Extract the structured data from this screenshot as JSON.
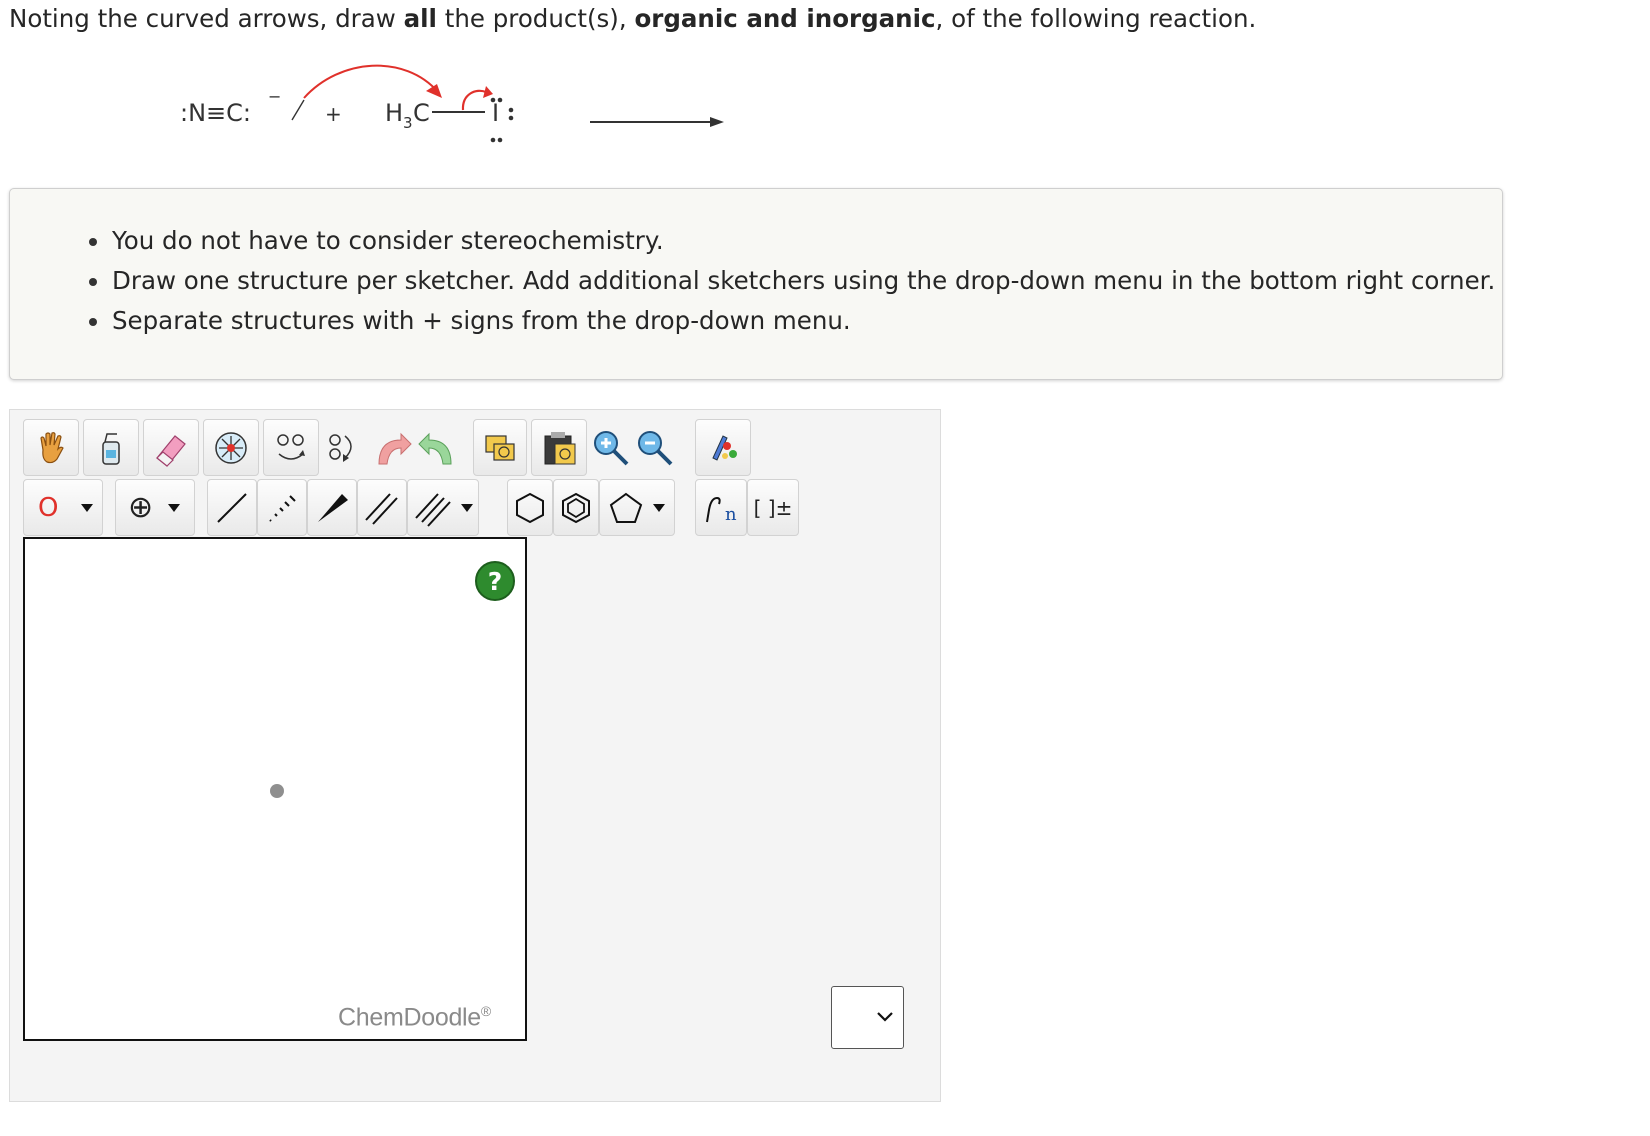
{
  "question": {
    "part1": "Noting the curved arrows, draw ",
    "bold1": "all",
    "part2": " the product(s), ",
    "bold2": "organic and inorganic",
    "part3": ", of the following reaction."
  },
  "reaction": {
    "reactant1_atoms": ":N≡C:",
    "charge": "−",
    "plus": "+",
    "reactant2_left": "H",
    "reactant2_sub": "3",
    "reactant2_c": "C",
    "reactant2_i": "I",
    "arrow_color": "#e0312b"
  },
  "notes": [
    "You do not have to consider stereochemistry.",
    "Draw one structure per sketcher. Add additional sketchers using the drop-down menu in the bottom right corner.",
    "Separate structures with + signs from the drop-down menu."
  ],
  "toolbar": {
    "row1": [
      "hand-tool",
      "clear-tool",
      "eraser-tool",
      "center-tool",
      "flip-tool",
      "rotate-tool",
      "undo-tool",
      "redo-tool",
      "copy-tool",
      "paste-tool",
      "zoom-in-tool",
      "zoom-out-tool",
      "clean-tool"
    ],
    "atom_label": "O",
    "charge_label": "⊕",
    "bracket_label": "[ ]±",
    "repeat_label": "n"
  },
  "sketcher": {
    "help_label": "?",
    "watermark": "ChemDoodle",
    "watermark_mark": "®"
  },
  "add_sketcher_select": {
    "value": ""
  }
}
